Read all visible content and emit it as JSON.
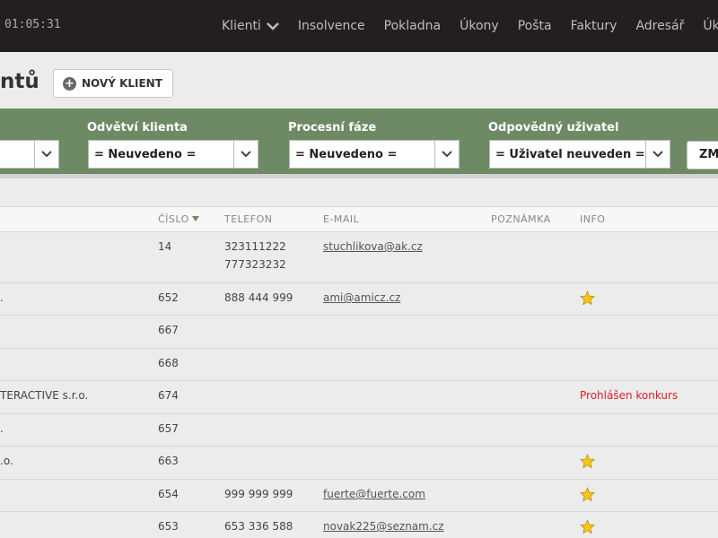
{
  "header": {
    "clock": "01:05:31",
    "nav": [
      {
        "label": "Klienti",
        "dropdown": true
      },
      {
        "label": "Insolvence"
      },
      {
        "label": "Pokladna"
      },
      {
        "label": "Úkony"
      },
      {
        "label": "Pošta"
      },
      {
        "label": "Faktury"
      },
      {
        "label": "Adresář"
      },
      {
        "label": "Úkol"
      }
    ]
  },
  "page": {
    "title": "ntů",
    "new_button_label": "NOVÝ KLIENT",
    "new_button_icon": "plus-circle-icon"
  },
  "filters": {
    "select0": {
      "value": ""
    },
    "industry": {
      "label": "Odvětví klienta",
      "value": "= Neuvedeno ="
    },
    "phase": {
      "label": "Procesní fáze",
      "value": "= Neuvedeno ="
    },
    "user": {
      "label": "Odpovědný uživatel",
      "value": "= Uživatel neuveden ="
    },
    "button_label": "ZM"
  },
  "table": {
    "columns": {
      "number": "ČÍSLO",
      "phone": "TELEFON",
      "email": "E-MAIL",
      "note": "POZNÁMKA",
      "info": "INFO"
    },
    "rows": [
      {
        "name": "",
        "number": "14",
        "phone": "323111222",
        "phone2": "777323232",
        "email": "stuchlikova@ak.cz",
        "info": "",
        "star": false
      },
      {
        "name": ".",
        "number": "652",
        "phone": "888 444 999",
        "email": "ami@amicz.cz",
        "info": "",
        "star": true
      },
      {
        "name": "",
        "number": "667",
        "phone": "",
        "email": "",
        "info": "",
        "star": false
      },
      {
        "name": "",
        "number": "668",
        "phone": "",
        "email": "",
        "info": "",
        "star": false
      },
      {
        "name": "TERACTIVE s.r.o.",
        "number": "674",
        "phone": "",
        "email": "",
        "info": "Prohlášen konkurs",
        "star": false
      },
      {
        "name": ".",
        "number": "657",
        "phone": "",
        "email": "",
        "info": "",
        "star": false
      },
      {
        "name": ".o.",
        "number": "663",
        "phone": "",
        "email": "",
        "info": "",
        "star": true
      },
      {
        "name": "",
        "number": "654",
        "phone": "999 999 999",
        "email": "fuerte@fuerte.com",
        "info": "",
        "star": true
      },
      {
        "name": "",
        "number": "653",
        "phone": "653 336 588",
        "email": "novak225@seznam.cz",
        "info": "",
        "star": true
      }
    ]
  },
  "colors": {
    "topbar": "#231f20",
    "filter_bar": "#6e8a65",
    "alert": "#d81e27",
    "star": "#f5c518"
  }
}
